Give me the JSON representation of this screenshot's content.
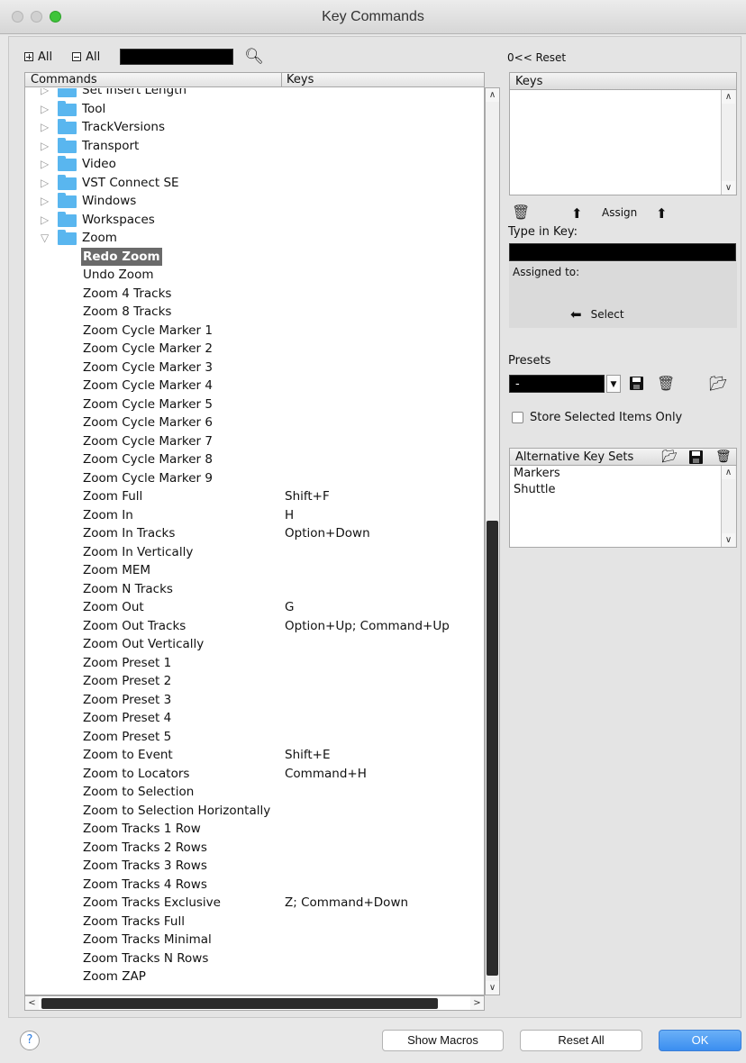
{
  "window": {
    "title": "Key Commands"
  },
  "toolbar": {
    "expand_all": "All",
    "collapse_all": "All",
    "search_value": ""
  },
  "list": {
    "col_commands": "Commands",
    "col_keys": "Keys",
    "folders": [
      {
        "label": "Set Insert Length",
        "expanded": false
      },
      {
        "label": "Tool",
        "expanded": false
      },
      {
        "label": "TrackVersions",
        "expanded": false
      },
      {
        "label": "Transport",
        "expanded": false
      },
      {
        "label": "Video",
        "expanded": false
      },
      {
        "label": "VST Connect SE",
        "expanded": false
      },
      {
        "label": "Windows",
        "expanded": false
      },
      {
        "label": "Workspaces",
        "expanded": false
      },
      {
        "label": "Zoom",
        "expanded": true
      }
    ],
    "commands": [
      {
        "name": "Redo Zoom",
        "keys": "",
        "selected": true
      },
      {
        "name": "Undo Zoom",
        "keys": ""
      },
      {
        "name": "Zoom 4 Tracks",
        "keys": ""
      },
      {
        "name": "Zoom 8 Tracks",
        "keys": ""
      },
      {
        "name": "Zoom Cycle Marker 1",
        "keys": ""
      },
      {
        "name": "Zoom Cycle Marker 2",
        "keys": ""
      },
      {
        "name": "Zoom Cycle Marker 3",
        "keys": ""
      },
      {
        "name": "Zoom Cycle Marker 4",
        "keys": ""
      },
      {
        "name": "Zoom Cycle Marker 5",
        "keys": ""
      },
      {
        "name": "Zoom Cycle Marker 6",
        "keys": ""
      },
      {
        "name": "Zoom Cycle Marker 7",
        "keys": ""
      },
      {
        "name": "Zoom Cycle Marker 8",
        "keys": ""
      },
      {
        "name": "Zoom Cycle Marker 9",
        "keys": ""
      },
      {
        "name": "Zoom Full",
        "keys": "Shift+F"
      },
      {
        "name": "Zoom In",
        "keys": "H"
      },
      {
        "name": "Zoom In Tracks",
        "keys": "Option+Down"
      },
      {
        "name": "Zoom In Vertically",
        "keys": ""
      },
      {
        "name": "Zoom MEM",
        "keys": ""
      },
      {
        "name": "Zoom N Tracks",
        "keys": ""
      },
      {
        "name": "Zoom Out",
        "keys": "G"
      },
      {
        "name": "Zoom Out Tracks",
        "keys": "Option+Up; Command+Up"
      },
      {
        "name": "Zoom Out Vertically",
        "keys": ""
      },
      {
        "name": "Zoom Preset 1",
        "keys": ""
      },
      {
        "name": "Zoom Preset 2",
        "keys": ""
      },
      {
        "name": "Zoom Preset 3",
        "keys": ""
      },
      {
        "name": "Zoom Preset 4",
        "keys": ""
      },
      {
        "name": "Zoom Preset 5",
        "keys": ""
      },
      {
        "name": "Zoom to Event",
        "keys": "Shift+E"
      },
      {
        "name": "Zoom to Locators",
        "keys": "Command+H"
      },
      {
        "name": "Zoom to Selection",
        "keys": ""
      },
      {
        "name": "Zoom to Selection Horizontally",
        "keys": ""
      },
      {
        "name": "Zoom Tracks 1 Row",
        "keys": ""
      },
      {
        "name": "Zoom Tracks 2 Rows",
        "keys": ""
      },
      {
        "name": "Zoom Tracks 3 Rows",
        "keys": ""
      },
      {
        "name": "Zoom Tracks 4 Rows",
        "keys": ""
      },
      {
        "name": "Zoom Tracks Exclusive",
        "keys": "Z; Command+Down"
      },
      {
        "name": "Zoom Tracks Full",
        "keys": ""
      },
      {
        "name": "Zoom Tracks Minimal",
        "keys": ""
      },
      {
        "name": "Zoom Tracks N Rows",
        "keys": ""
      },
      {
        "name": "Zoom ZAP",
        "keys": ""
      }
    ]
  },
  "right": {
    "reset_label": "0<< Reset",
    "keys_header": "Keys",
    "assign_label": "Assign",
    "type_in_key_label": "Type in Key:",
    "type_in_key_value": "",
    "assigned_to_label": "Assigned to:",
    "select_label": "Select",
    "presets_label": "Presets",
    "presets_value": "-",
    "store_selected_label": "Store Selected Items Only",
    "alt_header": "Alternative Key Sets",
    "alt_items": [
      "Markers",
      "Shuttle"
    ]
  },
  "bottom": {
    "help_label": "?",
    "show_macros": "Show Macros",
    "reset_all": "Reset All",
    "ok": "OK"
  },
  "colors": {
    "accent": "#3b8ef0",
    "folder": "#59b6ef",
    "selection": "#6a6a6a"
  }
}
